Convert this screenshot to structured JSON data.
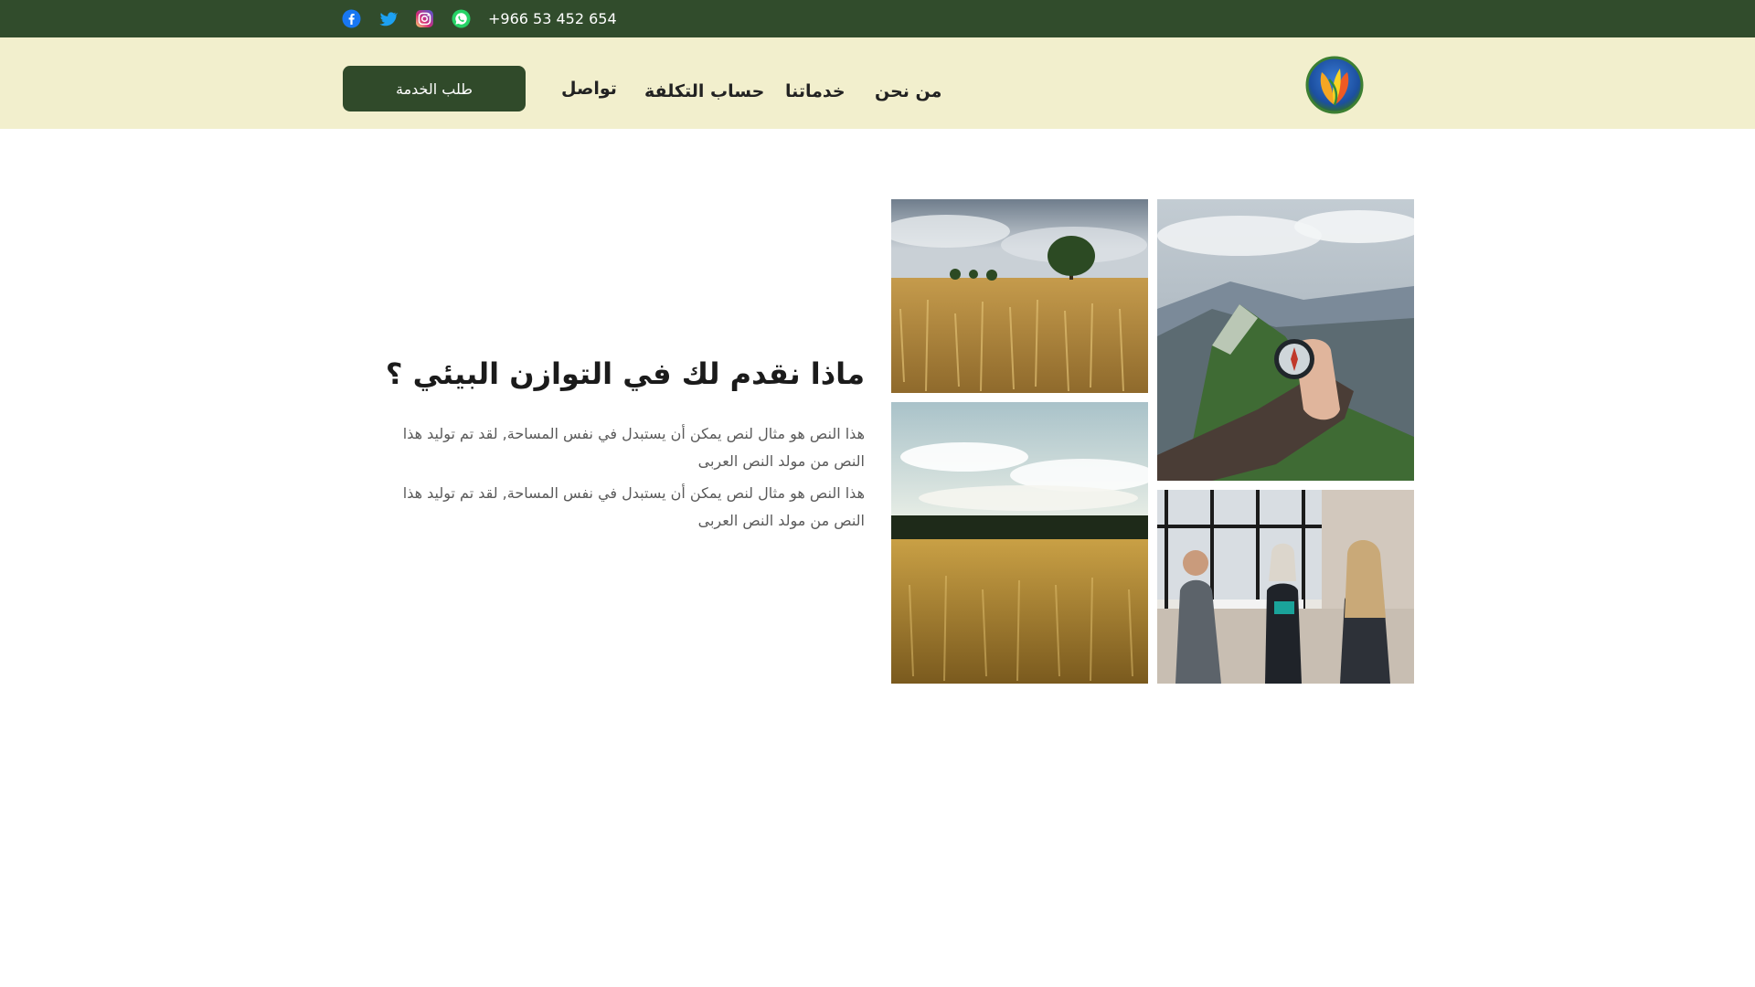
{
  "topbar": {
    "phone": "+966 53 452 654",
    "social": [
      {
        "icon": "facebook-icon",
        "color": "#1877f2"
      },
      {
        "icon": "twitter-icon",
        "color": "#1da1f2"
      },
      {
        "icon": "instagram-icon",
        "color": "#e1306c"
      },
      {
        "icon": "whatsapp-icon",
        "color": "#25d366"
      }
    ],
    "background": "#314c2c"
  },
  "header": {
    "background": "#f2efcd",
    "cta_label": "طلب الخدمة",
    "nav": {
      "contact": "تواصل",
      "cost": "حساب التكلفة",
      "services": "خدماتنا",
      "about": "من نحن"
    },
    "logo_icon": "leaf-logo-icon"
  },
  "main": {
    "headline": "ماذا نقدم لك في التوازن البيئي ؟",
    "paragraphs": [
      "هذا النص هو مثال لنص يمكن أن يستبدل في نفس المساحة, لقد تم توليد هذا النص من مولد النص العربى",
      "هذا النص هو مثال لنص يمكن أن يستبدل في نفس المساحة, لقد تم توليد هذا النص من مولد النص العربى"
    ],
    "images": [
      {
        "name": "wheat-field-tree-image"
      },
      {
        "name": "mountain-compass-image"
      },
      {
        "name": "golden-field-image"
      },
      {
        "name": "office-meeting-image"
      }
    ]
  },
  "colors": {
    "accent_dark_green": "#304a2a",
    "text_dark": "#1b1b1b",
    "text_muted": "#5a5a5a"
  }
}
